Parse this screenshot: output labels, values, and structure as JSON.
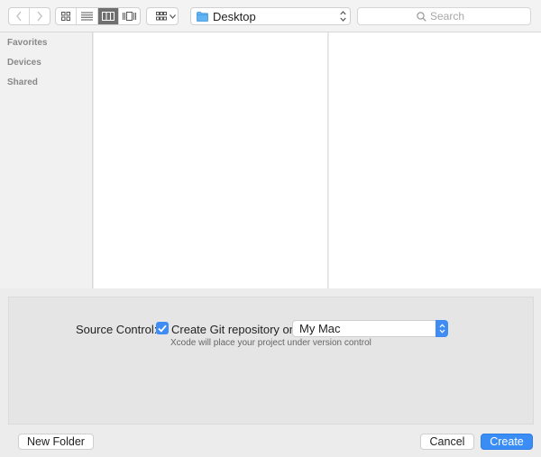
{
  "toolbar": {
    "back_icon": "chevron-left-icon",
    "forward_icon": "chevron-right-icon",
    "view_modes": [
      {
        "name": "icon-view-icon",
        "active": false
      },
      {
        "name": "list-view-icon",
        "active": false
      },
      {
        "name": "column-view-icon",
        "active": true
      },
      {
        "name": "coverflow-view-icon",
        "active": false
      }
    ],
    "arrange_icon": "arrange-grid-icon",
    "location": "Desktop",
    "location_icon": "folder-icon",
    "search_placeholder": "Search"
  },
  "sidebar": {
    "sections": [
      {
        "label": "Favorites"
      },
      {
        "label": "Devices"
      },
      {
        "label": "Shared"
      }
    ]
  },
  "accessory": {
    "source_control_label": "Source Control:",
    "create_git_label": "Create Git repository on",
    "create_git_checked": true,
    "repository_location": "My Mac",
    "hint": "Xcode will place your project under version control"
  },
  "buttons": {
    "new_folder": "New Folder",
    "cancel": "Cancel",
    "create": "Create"
  },
  "colors": {
    "accent": "#3a8df5",
    "window_bg": "#ececec",
    "sidebar_bg": "#f1f1f1"
  }
}
